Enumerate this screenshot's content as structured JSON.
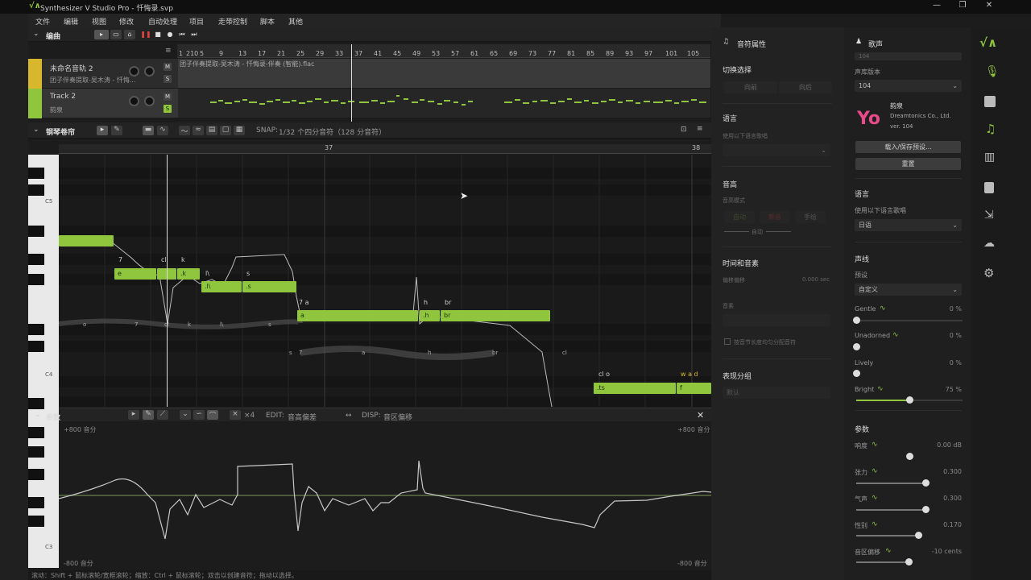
{
  "window": {
    "title": "Synthesizer V Studio Pro - 忏悔录.svp",
    "min_glyph": "—",
    "max_glyph": "❐",
    "close_glyph": "✕"
  },
  "menu": [
    "文件",
    "编辑",
    "视图",
    "修改",
    "自动处理",
    "项目",
    "走带控制",
    "脚本",
    "其他"
  ],
  "arrangement": {
    "label": "编曲",
    "bars": [
      "1",
      "210",
      "5",
      "9",
      "13",
      "17",
      "21",
      "25",
      "29",
      "33",
      "37",
      "41",
      "45",
      "49",
      "53",
      "57",
      "61",
      "65",
      "69",
      "73",
      "77",
      "81",
      "85",
      "89",
      "93",
      "97",
      "101",
      "105"
    ],
    "tracks": [
      {
        "name": "未命名音轨 2",
        "sub": "团子伴奏提取-吴木涛 - 忏悔... ",
        "lane_text": "团子伴奏提取-吴木涛 - 忏悔录-伴奏 (智能).flac",
        "m": "M",
        "s": "S"
      },
      {
        "name": "Track 2",
        "sub": "韵泉",
        "lane_text": "",
        "m": "M",
        "s": "S"
      }
    ]
  },
  "piano_roll": {
    "label": "钢琴卷帘",
    "snap_label": "SNAP:",
    "snap_value": "1/32 个四分音符（128 分音符）",
    "bar_37": "37",
    "bar_38": "38",
    "octaves": [
      "C5",
      "C4",
      "C3"
    ],
    "notes": [
      {
        "lyric": "",
        "top": "7",
        "pron": ""
      },
      {
        "lyric": "e",
        "top": "7",
        "pron": ""
      },
      {
        "lyric": "",
        "top": "cl",
        "pron": ""
      },
      {
        "lyric": ".k",
        "top": "k",
        "pron": ""
      },
      {
        "lyric": ".l\\",
        "top": "l\\",
        "pron": ""
      },
      {
        "lyric": ".s",
        "top": "s",
        "pron": ""
      },
      {
        "lyric": "a",
        "top": "7   a",
        "pron": "c"
      },
      {
        "lyric": ".h",
        "top": "h",
        "pron": ""
      },
      {
        "lyric": "br",
        "top": "br",
        "pron": ""
      },
      {
        "lyric": ".ts",
        "top": "cl o",
        "pron": ""
      },
      {
        "lyric": "f",
        "top": "w a d",
        "pron": ""
      }
    ],
    "phonemes_upper": [
      "o",
      "7",
      "cl",
      "k",
      "l\\",
      "s"
    ],
    "phonemes_lower": [
      "s",
      "7",
      "a",
      "h",
      "br",
      "cl"
    ]
  },
  "params": {
    "label": "参数",
    "edit_label": "EDIT:",
    "edit_value": "音高偏差",
    "disp_label": "DISP:",
    "disp_value": "音区偏移",
    "top_left": "+800 音分",
    "top_right": "+800 音分",
    "bottom_left": "-800 音分",
    "bottom_right": "-800 音分",
    "x4": "×4"
  },
  "status": "滚动：Shift + 鼠标滚轮/宽框滚轮；缩放：Ctrl + 鼠标滚轮；双击以创建音符；拖动以选择。",
  "note_props": {
    "title": "音符属性",
    "switch_label": "切换选择",
    "prev": "向前",
    "next": "向后",
    "lang_section": "语言",
    "lang_sub": "使用以下语言歌唱",
    "pitch_section": "音高",
    "pitch_mode": "音高模式",
    "pitch_modes": [
      "自动",
      "颤音",
      "手绘"
    ],
    "auto": "自动",
    "timing_section": "时间和音素",
    "offset_label": "偏移偏移",
    "offset_value": "0.000 sec",
    "phoneme_label": "音素",
    "checkbox_label": "按音节长度均匀分配音符",
    "expr_section": "表现分组",
    "expr_value": "默认"
  },
  "voice": {
    "title": "歌声",
    "top_field": "104",
    "db_label": "声库版本",
    "db_value": "104",
    "singer": "韵泉",
    "company": "Dreamtonics Co., Ltd.",
    "version": "ver. 104",
    "load_save": "载入/保存预设...",
    "reset": "重置",
    "lang_section": "语言",
    "lang_sub": "使用以下语言歌唱",
    "lang_value": "日语",
    "tone_section": "声线",
    "preset_label": "预设",
    "preset_value": "自定义",
    "tone_sliders": [
      {
        "name": "Gentle",
        "value": "0 %",
        "level": 0
      },
      {
        "name": "Unadorned",
        "value": "0 %",
        "level": 0
      },
      {
        "name": "Lively",
        "value": "0 %",
        "level": 0
      },
      {
        "name": "Bright",
        "value": "75 %",
        "level": 0.5
      }
    ],
    "param_section": "参数",
    "param_sliders": [
      {
        "name": "响度",
        "value": "0.00 dB",
        "level": 0.5
      },
      {
        "name": "张力",
        "value": "0.300",
        "level": 0.65
      },
      {
        "name": "气声",
        "value": "0.300",
        "level": 0.65
      },
      {
        "name": "性别",
        "value": "0.170",
        "level": 0.58
      },
      {
        "name": "音区偏移",
        "value": "-10 cents",
        "level": 0.49
      }
    ]
  },
  "sidebar_icons": [
    "app-logo",
    "microphone-icon",
    "clapper-icon",
    "music-note-icon",
    "library-icon",
    "book-icon",
    "export-icon",
    "cloud-icon",
    "gear-icon"
  ],
  "colors": {
    "accent": "#8fc63e",
    "track1": "#d9b72c",
    "track2": "#8fc63e",
    "record": "#e0443c"
  }
}
